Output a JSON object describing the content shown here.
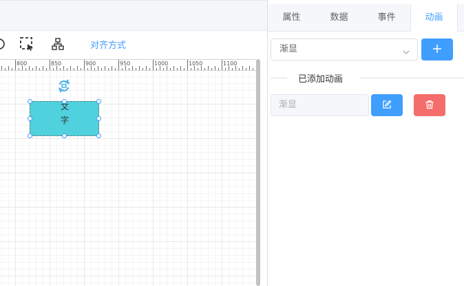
{
  "toolbar": {
    "align_label": "对齐方式"
  },
  "ruler": {
    "labels": [
      "800",
      "850",
      "900",
      "950",
      "1000",
      "1050",
      "1100"
    ]
  },
  "canvas": {
    "element_text": "文字"
  },
  "panel": {
    "tabs": [
      {
        "label": "属性",
        "active": false
      },
      {
        "label": "数据",
        "active": false
      },
      {
        "label": "事件",
        "active": false
      },
      {
        "label": "动画",
        "active": true
      }
    ],
    "animation_select_value": "渐显",
    "added_section_title": "已添加动画",
    "added_items": [
      {
        "name": "渐显"
      }
    ]
  },
  "colors": {
    "accent": "#409eff",
    "danger": "#f56c6c",
    "element_fill": "#4fd1de"
  }
}
